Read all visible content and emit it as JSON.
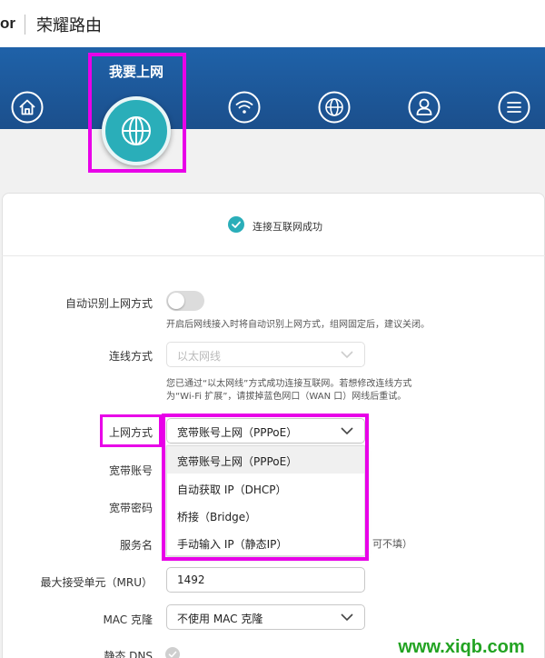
{
  "header": {
    "brand_fragment": "or",
    "app_title": "荣耀路由"
  },
  "nav": {
    "active_label": "我要上网",
    "items": [
      {
        "icon": "home-icon",
        "active": false
      },
      {
        "icon": "globe-icon",
        "active": true
      },
      {
        "icon": "wifi-icon",
        "active": false
      },
      {
        "icon": "globe-network-icon",
        "active": false
      },
      {
        "icon": "user-icon",
        "active": false
      },
      {
        "icon": "menu-icon",
        "active": false
      }
    ]
  },
  "status": {
    "text": "连接互联网成功",
    "icon": "check-circle-icon"
  },
  "form": {
    "auto_detect": {
      "label": "自动识别上网方式",
      "enabled": false,
      "hint": "开启后网线接入时将自动识别上网方式，组网固定后，建议关闭。"
    },
    "connection_type": {
      "label": "连线方式",
      "value": "以太网线",
      "hint_line1": "您已通过“以太网线”方式成功连接互联网。若想修改连线方式",
      "hint_line2": "为“Wi-Fi 扩展”，请拔掉蓝色网口（WAN 口）网线后重试。"
    },
    "internet_mode": {
      "label": "上网方式",
      "value": "宽带账号上网（PPPoE）",
      "options": [
        "宽带账号上网（PPPoE）",
        "自动获取 IP（DHCP）",
        "桥接（Bridge）",
        "手动输入 IP（静态IP）"
      ]
    },
    "broadband_account": {
      "label": "宽带账号"
    },
    "broadband_password": {
      "label": "宽带密码"
    },
    "service_name": {
      "label": "服务名",
      "suffix_hint": "可不填）"
    },
    "mru": {
      "label": "最大接受单元（MRU）",
      "value": "1492"
    },
    "mac_clone": {
      "label": "MAC 克隆",
      "value": "不使用 MAC 克隆"
    },
    "static_dns": {
      "label": "静态 DNS"
    }
  },
  "watermark": "www.xiqb.com",
  "colors": {
    "nav_bg": "#1b5a9e",
    "accent": "#2aaeb9",
    "highlight": "#e800e8"
  }
}
